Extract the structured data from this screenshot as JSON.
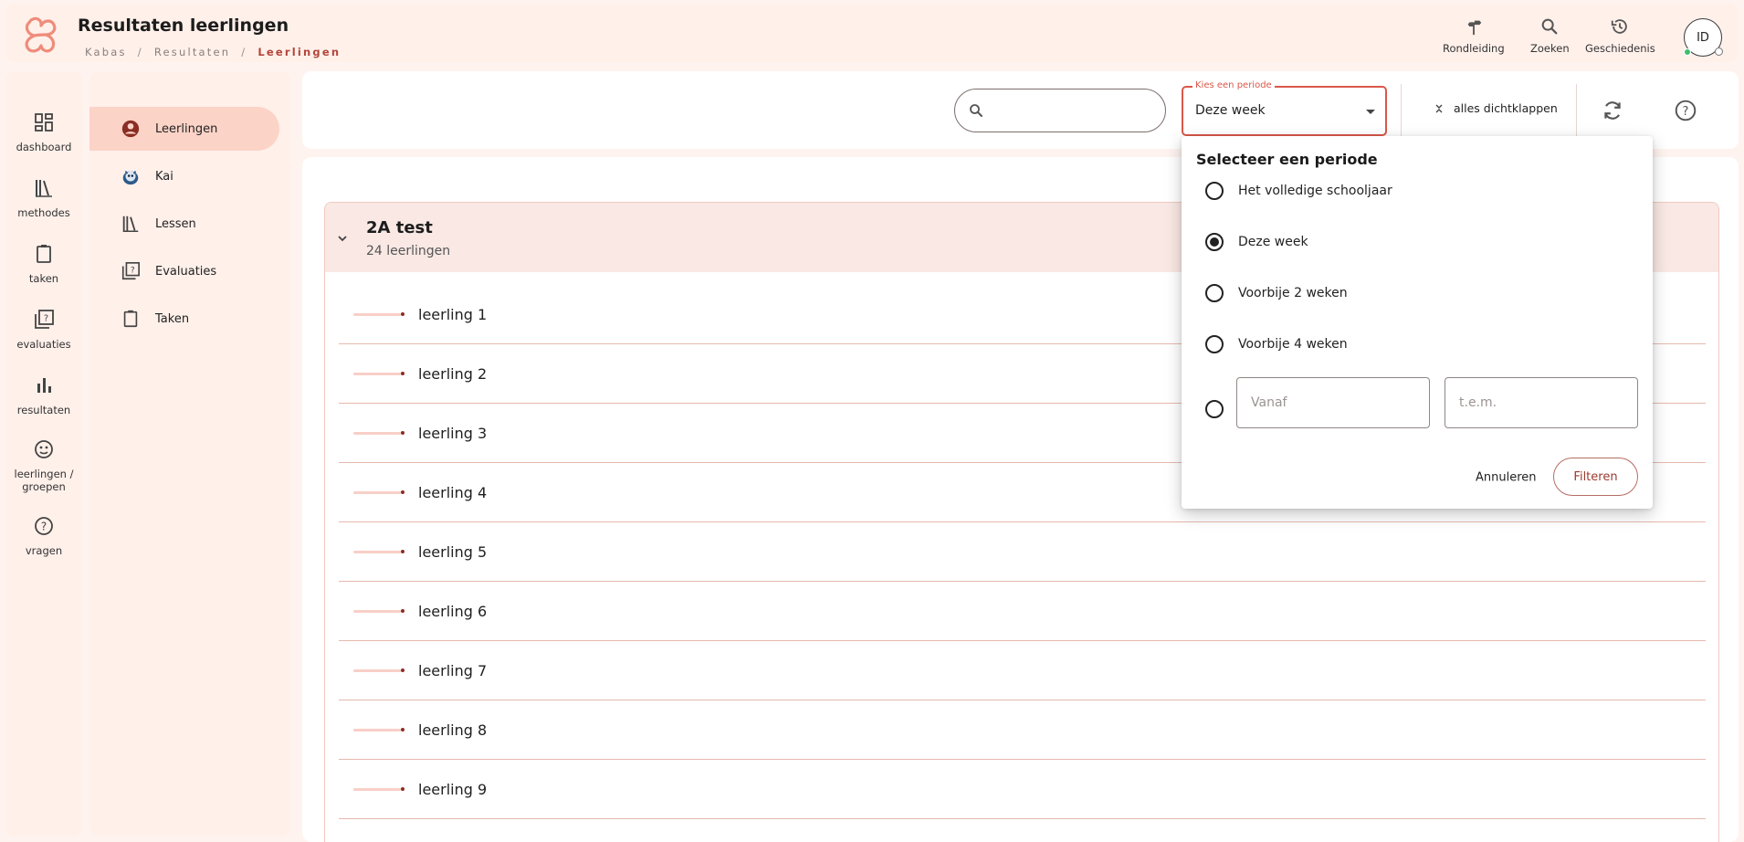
{
  "header": {
    "title": "Resultaten leerlingen",
    "breadcrumb": [
      "Kabas",
      "Resultaten",
      "Leerlingen"
    ],
    "breadcrumb_sep": "/",
    "tools": {
      "tour": {
        "label": "Rondleiding",
        "icon": "signpost-icon"
      },
      "search": {
        "label": "Zoeken",
        "icon": "search-icon"
      },
      "history": {
        "label": "Geschiedenis",
        "icon": "history-icon"
      }
    },
    "avatar_initials": "ID"
  },
  "rail": {
    "items": [
      {
        "label": "dashboard",
        "icon": "dashboard-icon"
      },
      {
        "label": "methodes",
        "icon": "books-icon"
      },
      {
        "label": "taken",
        "icon": "clipboard-icon"
      },
      {
        "label": "evaluaties",
        "icon": "quiz-icon"
      },
      {
        "label": "resultaten",
        "icon": "bar-chart-icon"
      },
      {
        "label": "leerlingen / groepen",
        "icon": "face-icon"
      },
      {
        "label": "vragen",
        "icon": "help-icon"
      }
    ]
  },
  "subnav": {
    "items": [
      {
        "label": "Leerlingen",
        "icon": "account-icon",
        "active": true
      },
      {
        "label": "Kai",
        "icon": "kai-robot-icon"
      },
      {
        "label": "Lessen",
        "icon": "books-icon"
      },
      {
        "label": "Evaluaties",
        "icon": "quiz-icon"
      },
      {
        "label": "Taken",
        "icon": "clipboard-icon"
      }
    ]
  },
  "toolbar": {
    "search_value": "",
    "period_label": "Kies een periode",
    "period_value": "Deze week",
    "collapse_all": "alles dichtklappen"
  },
  "group": {
    "title": "2A test",
    "subtitle": "24 leerlingen",
    "students": [
      "leerling 1",
      "leerling 2",
      "leerling 3",
      "leerling 4",
      "leerling 5",
      "leerling 6",
      "leerling 7",
      "leerling 8",
      "leerling 9"
    ]
  },
  "period_popover": {
    "title": "Selecteer een periode",
    "options": [
      "Het volledige schooljaar",
      "Deze week",
      "Voorbije 2 weken",
      "Voorbije 4 weken"
    ],
    "selected_index": 1,
    "from_placeholder": "Vanaf",
    "to_placeholder": "t.e.m.",
    "cancel": "Annuleren",
    "apply": "Filteren"
  },
  "colors": {
    "accent": "#d9584a",
    "active_nav": "#fcd3c7",
    "panel_bg": "#fff0ea"
  }
}
